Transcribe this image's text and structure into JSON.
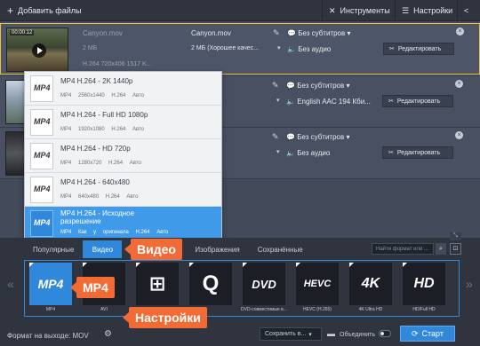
{
  "toolbar": {
    "add_files": "Добавить файлы",
    "tools": "Инструменты",
    "settings": "Настройки"
  },
  "files": [
    {
      "timecode": "00:00:12",
      "source_name": "Canyon.mov",
      "source_size": "2 МБ",
      "source_info": "H.264 720x406 1517 K...",
      "output_name": "Canyon.mov",
      "output_size": "2 МБ (Хорошее качес...",
      "subtitles": "Без субтитров",
      "audio": "Без аудио",
      "edit": "Редактировать"
    },
    {
      "output_name": "ov",
      "subtitles": "Без субтитров",
      "audio": "English AAC 194 Кби...",
      "edit": "Редактировать"
    },
    {
      "output_name": "ov",
      "subtitles": "Без субтитров",
      "audio": "Без аудио",
      "edit": "Редактировать"
    }
  ],
  "presets": [
    {
      "title": "MP4 H.264 - 2K 1440p",
      "details": "MP4 2560x1440 H.264 Авто"
    },
    {
      "title": "MP4 H.264 - Full HD 1080p",
      "details": "MP4 1920x1080 H.264 Авто"
    },
    {
      "title": "MP4 H.264 - HD 720p",
      "details": "MP4 1280x720 H.264 Авто"
    },
    {
      "title": "MP4 H.264 - 640x480",
      "details": "MP4 640x480 H.264 Авто"
    },
    {
      "title": "MP4 H.264 - Исходное разрешение",
      "details": "MP4 Как у оригинала H.264 Авто"
    }
  ],
  "preset_icon_text": "MP4",
  "tabs": [
    {
      "label": "Популярные",
      "active": false
    },
    {
      "label": "Видео",
      "active": true
    },
    {
      "label": "",
      "active": false
    },
    {
      "label": "Изображения",
      "active": false
    },
    {
      "label": "Сохранённые",
      "active": false
    }
  ],
  "format_search_placeholder": "Найти формат или ...",
  "formats": [
    {
      "name": "MP4",
      "label": "MP4",
      "active": true
    },
    {
      "name": "AVI",
      "label": "AVI",
      "active": false
    },
    {
      "name": "WMV",
      "label": "",
      "active": false
    },
    {
      "name": "MOV",
      "label": "",
      "active": false
    },
    {
      "name": "DVD",
      "label": "DVD-совместимые в...",
      "active": false
    },
    {
      "name": "HEVC",
      "label": "HEVC (H.265)",
      "active": false
    },
    {
      "name": "4K",
      "label": "4K Ultra HD",
      "active": false
    },
    {
      "name": "HD",
      "label": "HD/Full HD",
      "active": false
    }
  ],
  "callouts": {
    "video": "Видео",
    "mp4": "MP4",
    "settings": "Настройки"
  },
  "bottom": {
    "output_format": "Формат на выходе: MOV",
    "save_in": "Сохранить в...",
    "merge": "Объединить",
    "start": "Старт"
  },
  "colors": {
    "accent": "#2f88da",
    "callout": "#f26b35",
    "selected_row_border": "#f2c03b"
  }
}
